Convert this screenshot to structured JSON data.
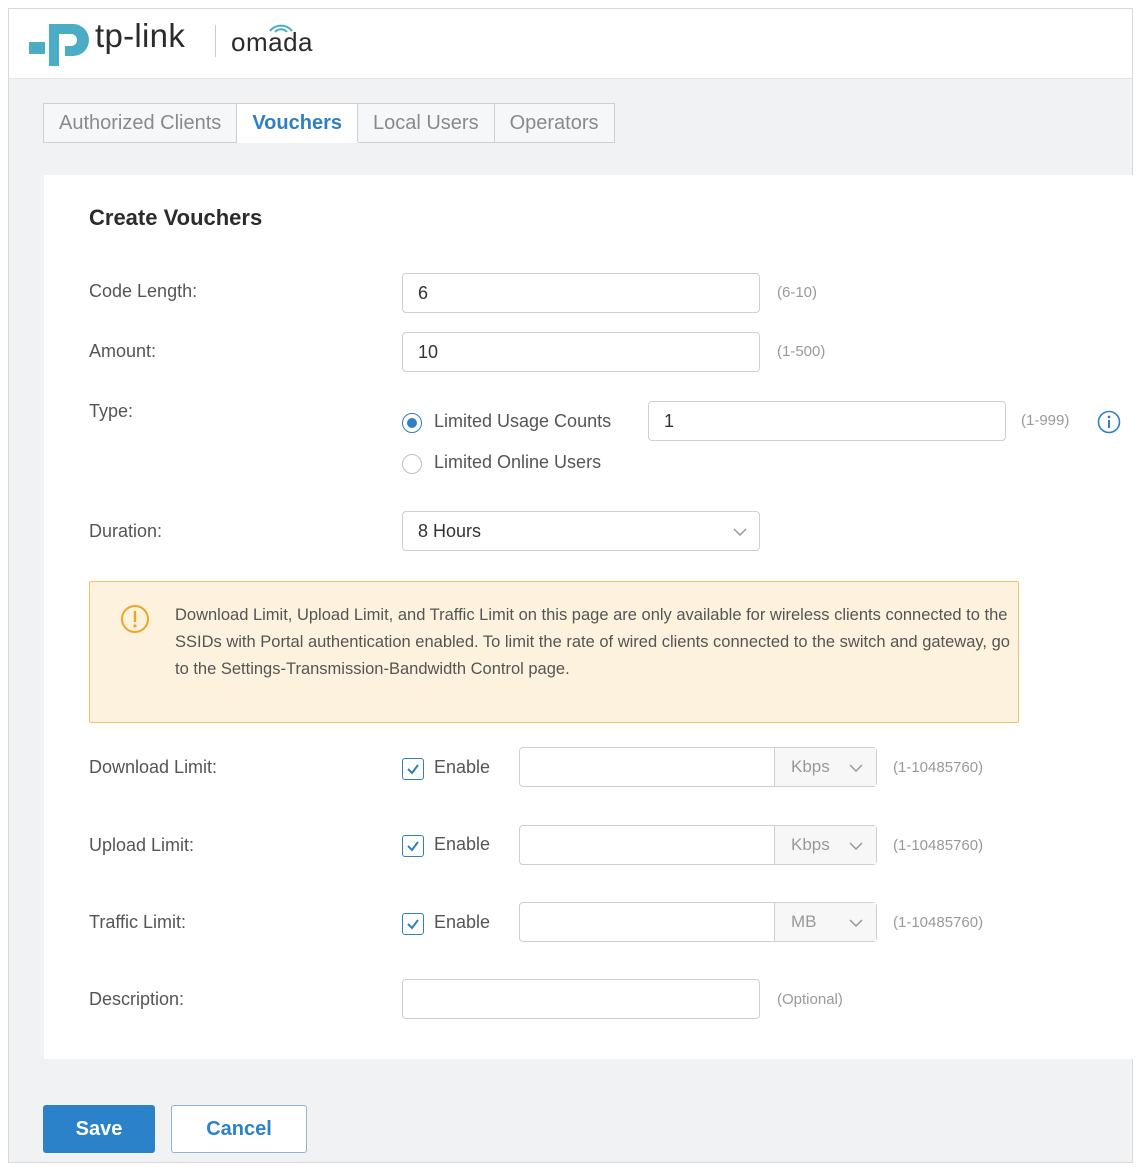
{
  "header": {
    "brand": "tp-link",
    "product": "omada"
  },
  "tabs": [
    {
      "label": "Authorized Clients",
      "active": false
    },
    {
      "label": "Vouchers",
      "active": true
    },
    {
      "label": "Local Users",
      "active": false
    },
    {
      "label": "Operators",
      "active": false
    }
  ],
  "form": {
    "title": "Create Vouchers",
    "code_length": {
      "label": "Code Length:",
      "value": "6",
      "hint": "(6-10)"
    },
    "amount": {
      "label": "Amount:",
      "value": "10",
      "hint": "(1-500)"
    },
    "type": {
      "label": "Type:",
      "options": [
        {
          "label": "Limited Usage Counts",
          "checked": true
        },
        {
          "label": "Limited Online Users",
          "checked": false
        }
      ],
      "count_value": "1",
      "hint": "(1-999)"
    },
    "duration": {
      "label": "Duration:",
      "value": "8 Hours"
    },
    "warning": "Download Limit, Upload Limit, and Traffic Limit on this page are only available for wireless clients connected to the SSIDs with Portal authentication enabled. To limit the rate of wired clients connected to the switch and gateway, go to the Settings-Transmission-Bandwidth Control page.",
    "download_limit": {
      "label": "Download Limit:",
      "enable_label": "Enable",
      "checked": true,
      "value": "",
      "unit": "Kbps",
      "hint": "(1-10485760)"
    },
    "upload_limit": {
      "label": "Upload Limit:",
      "enable_label": "Enable",
      "checked": true,
      "value": "",
      "unit": "Kbps",
      "hint": "(1-10485760)"
    },
    "traffic_limit": {
      "label": "Traffic Limit:",
      "enable_label": "Enable",
      "checked": true,
      "value": "",
      "unit": "MB",
      "hint": "(1-10485760)"
    },
    "description": {
      "label": "Description:",
      "value": "",
      "hint": "(Optional)"
    }
  },
  "actions": {
    "save_label": "Save",
    "cancel_label": "Cancel"
  },
  "colors": {
    "accent": "#2f7fc1",
    "warning_bg": "#fdf2dd",
    "warning_border": "#f3c36c",
    "brand_teal": "#4bacc6"
  }
}
